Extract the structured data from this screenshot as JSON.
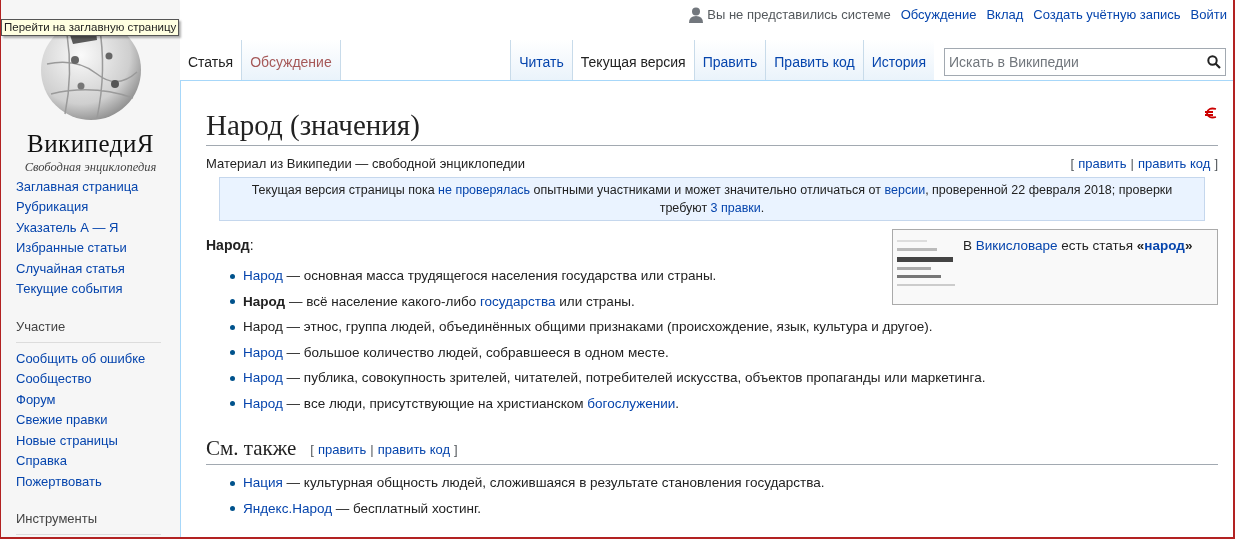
{
  "tooltip": "Перейти на заглавную страницу",
  "logo": {
    "wordmark": "ВикипедиЯ",
    "tagline": "Свободная энциклопедия"
  },
  "personal": {
    "user": "Вы не представились системе",
    "links": [
      "Обсуждение",
      "Вклад",
      "Создать учётную запись",
      "Войти"
    ]
  },
  "namespace_tabs": [
    {
      "label": "Статья",
      "selected": true
    },
    {
      "label": "Обсуждение",
      "selected": false,
      "missing": true
    }
  ],
  "view_tabs": [
    {
      "label": "Читать",
      "selected": false
    },
    {
      "label": "Текущая версия",
      "selected": true
    },
    {
      "label": "Править",
      "selected": false
    },
    {
      "label": "Править код",
      "selected": false
    },
    {
      "label": "История",
      "selected": false
    }
  ],
  "search": {
    "placeholder": "Искать в Википедии"
  },
  "sidebar": {
    "portals": [
      {
        "items": [
          "Заглавная страница",
          "Рубрикация",
          "Указатель А — Я",
          "Избранные статьи",
          "Случайная статья",
          "Текущие события"
        ]
      },
      {
        "heading": "Участие",
        "items": [
          "Сообщить об ошибке",
          "Сообщество",
          "Форум",
          "Свежие правки",
          "Новые страницы",
          "Справка",
          "Пожертвовать"
        ]
      },
      {
        "heading": "Инструменты"
      }
    ]
  },
  "article": {
    "title": "Народ (значения)",
    "tagline": "Материал из Википедии — свободной энциклопедии",
    "edit_links": {
      "open": "[",
      "separator": "|",
      "close": "]",
      "links": [
        "править",
        "править код"
      ]
    },
    "notice": [
      {
        "kind": "plain",
        "text": "Текущая версия страницы пока "
      },
      {
        "kind": "link",
        "text": "не проверялась"
      },
      {
        "kind": "plain",
        "text": " опытными участниками и может значительно отличаться от "
      },
      {
        "kind": "link",
        "text": "версии"
      },
      {
        "kind": "plain",
        "text": ", проверенной 22 февраля 2018; проверки требуют "
      },
      {
        "kind": "link",
        "text": "3 правки"
      },
      {
        "kind": "plain",
        "text": "."
      }
    ],
    "wiktionary": [
      {
        "kind": "plain",
        "text": "В "
      },
      {
        "kind": "link",
        "text": "Викисловаре"
      },
      {
        "kind": "plain",
        "text": " есть статья "
      },
      {
        "kind": "bold",
        "text": "«"
      },
      {
        "kind": "boldlink",
        "text": "народ"
      },
      {
        "kind": "bold",
        "text": "»"
      }
    ],
    "intro": [
      {
        "kind": "bold",
        "text": "Народ"
      },
      {
        "kind": "plain",
        "text": ":"
      }
    ],
    "items": [
      [
        {
          "kind": "link",
          "text": "Народ"
        },
        {
          "kind": "plain",
          "text": " — основная масса трудящегося населения государства или страны."
        }
      ],
      [
        {
          "kind": "bold",
          "text": "Народ"
        },
        {
          "kind": "plain",
          "text": " — всё население какого-либо "
        },
        {
          "kind": "link",
          "text": "государства"
        },
        {
          "kind": "plain",
          "text": " или страны."
        }
      ],
      [
        {
          "kind": "plain",
          "text": "Народ"
        },
        {
          "kind": "plain",
          "text": " — этнос, группа людей, объединённых общими признаками (происхождение, язык, культура и другое)."
        }
      ],
      [
        {
          "kind": "link",
          "text": "Народ"
        },
        {
          "kind": "plain",
          "text": " — большое количество людей, собравшееся в одном месте."
        }
      ],
      [
        {
          "kind": "link",
          "text": "Народ"
        },
        {
          "kind": "plain",
          "text": " — публика, совокупность зрителей, читателей, потребителей искусства, объектов пропаганды или маркетинга."
        }
      ],
      [
        {
          "kind": "link",
          "text": "Народ"
        },
        {
          "kind": "plain",
          "text": " — все люди, присутствующие на христианском "
        },
        {
          "kind": "link",
          "text": "богослужении"
        },
        {
          "kind": "plain",
          "text": "."
        }
      ]
    ],
    "sections": [
      {
        "heading": "См. также",
        "edit_links": {
          "open": "[",
          "separator": "|",
          "close": "]",
          "links": [
            "править",
            "править код"
          ]
        },
        "items": [
          [
            {
              "kind": "link",
              "text": "Нация"
            },
            {
              "kind": "plain",
              "text": " — культурная общность людей, сложившаяся в результате становления государства."
            }
          ],
          [
            {
              "kind": "link",
              "text": "Яндекс.Народ"
            },
            {
              "kind": "plain",
              "text": " — бесплатный хостинг."
            }
          ]
        ]
      }
    ]
  }
}
